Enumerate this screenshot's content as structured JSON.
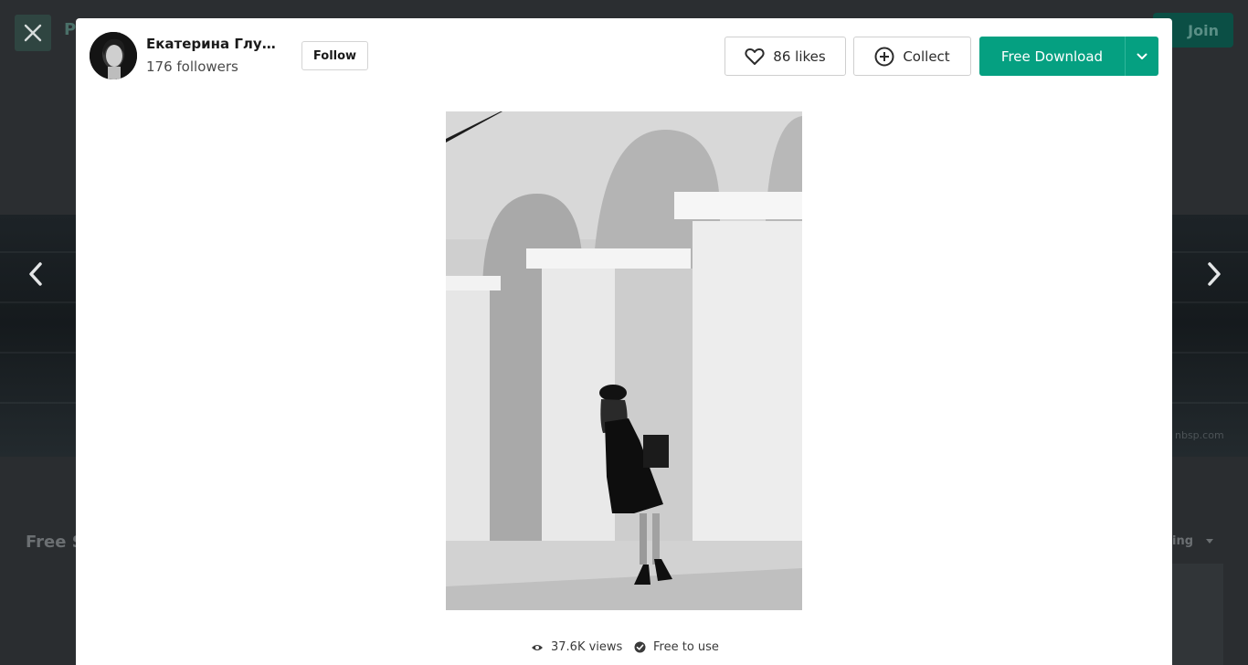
{
  "background": {
    "logo_text": "P",
    "join_label": "Join",
    "section_heading": "Free S",
    "sort_label": "ing",
    "credit_text": "nbsp.com"
  },
  "author": {
    "name": "Екатерина Глущ...",
    "followers": "176 followers",
    "follow_label": "Follow"
  },
  "actions": {
    "likes_label": "86 likes",
    "collect_label": "Collect",
    "download_label": "Free Download"
  },
  "photo_meta": {
    "views": "37.6K views",
    "license": "Free to use"
  },
  "icons": {
    "close": "close-icon",
    "prev": "chevron-left-icon",
    "next": "chevron-right-icon",
    "heart": "heart-icon",
    "collect": "plus-circle-icon",
    "dropdown": "chevron-down-icon",
    "views": "eye-icon",
    "license": "check-circle-icon"
  },
  "colors": {
    "accent": "#05a081",
    "overlay": "#1a1d20",
    "modal": "#ffffff"
  }
}
